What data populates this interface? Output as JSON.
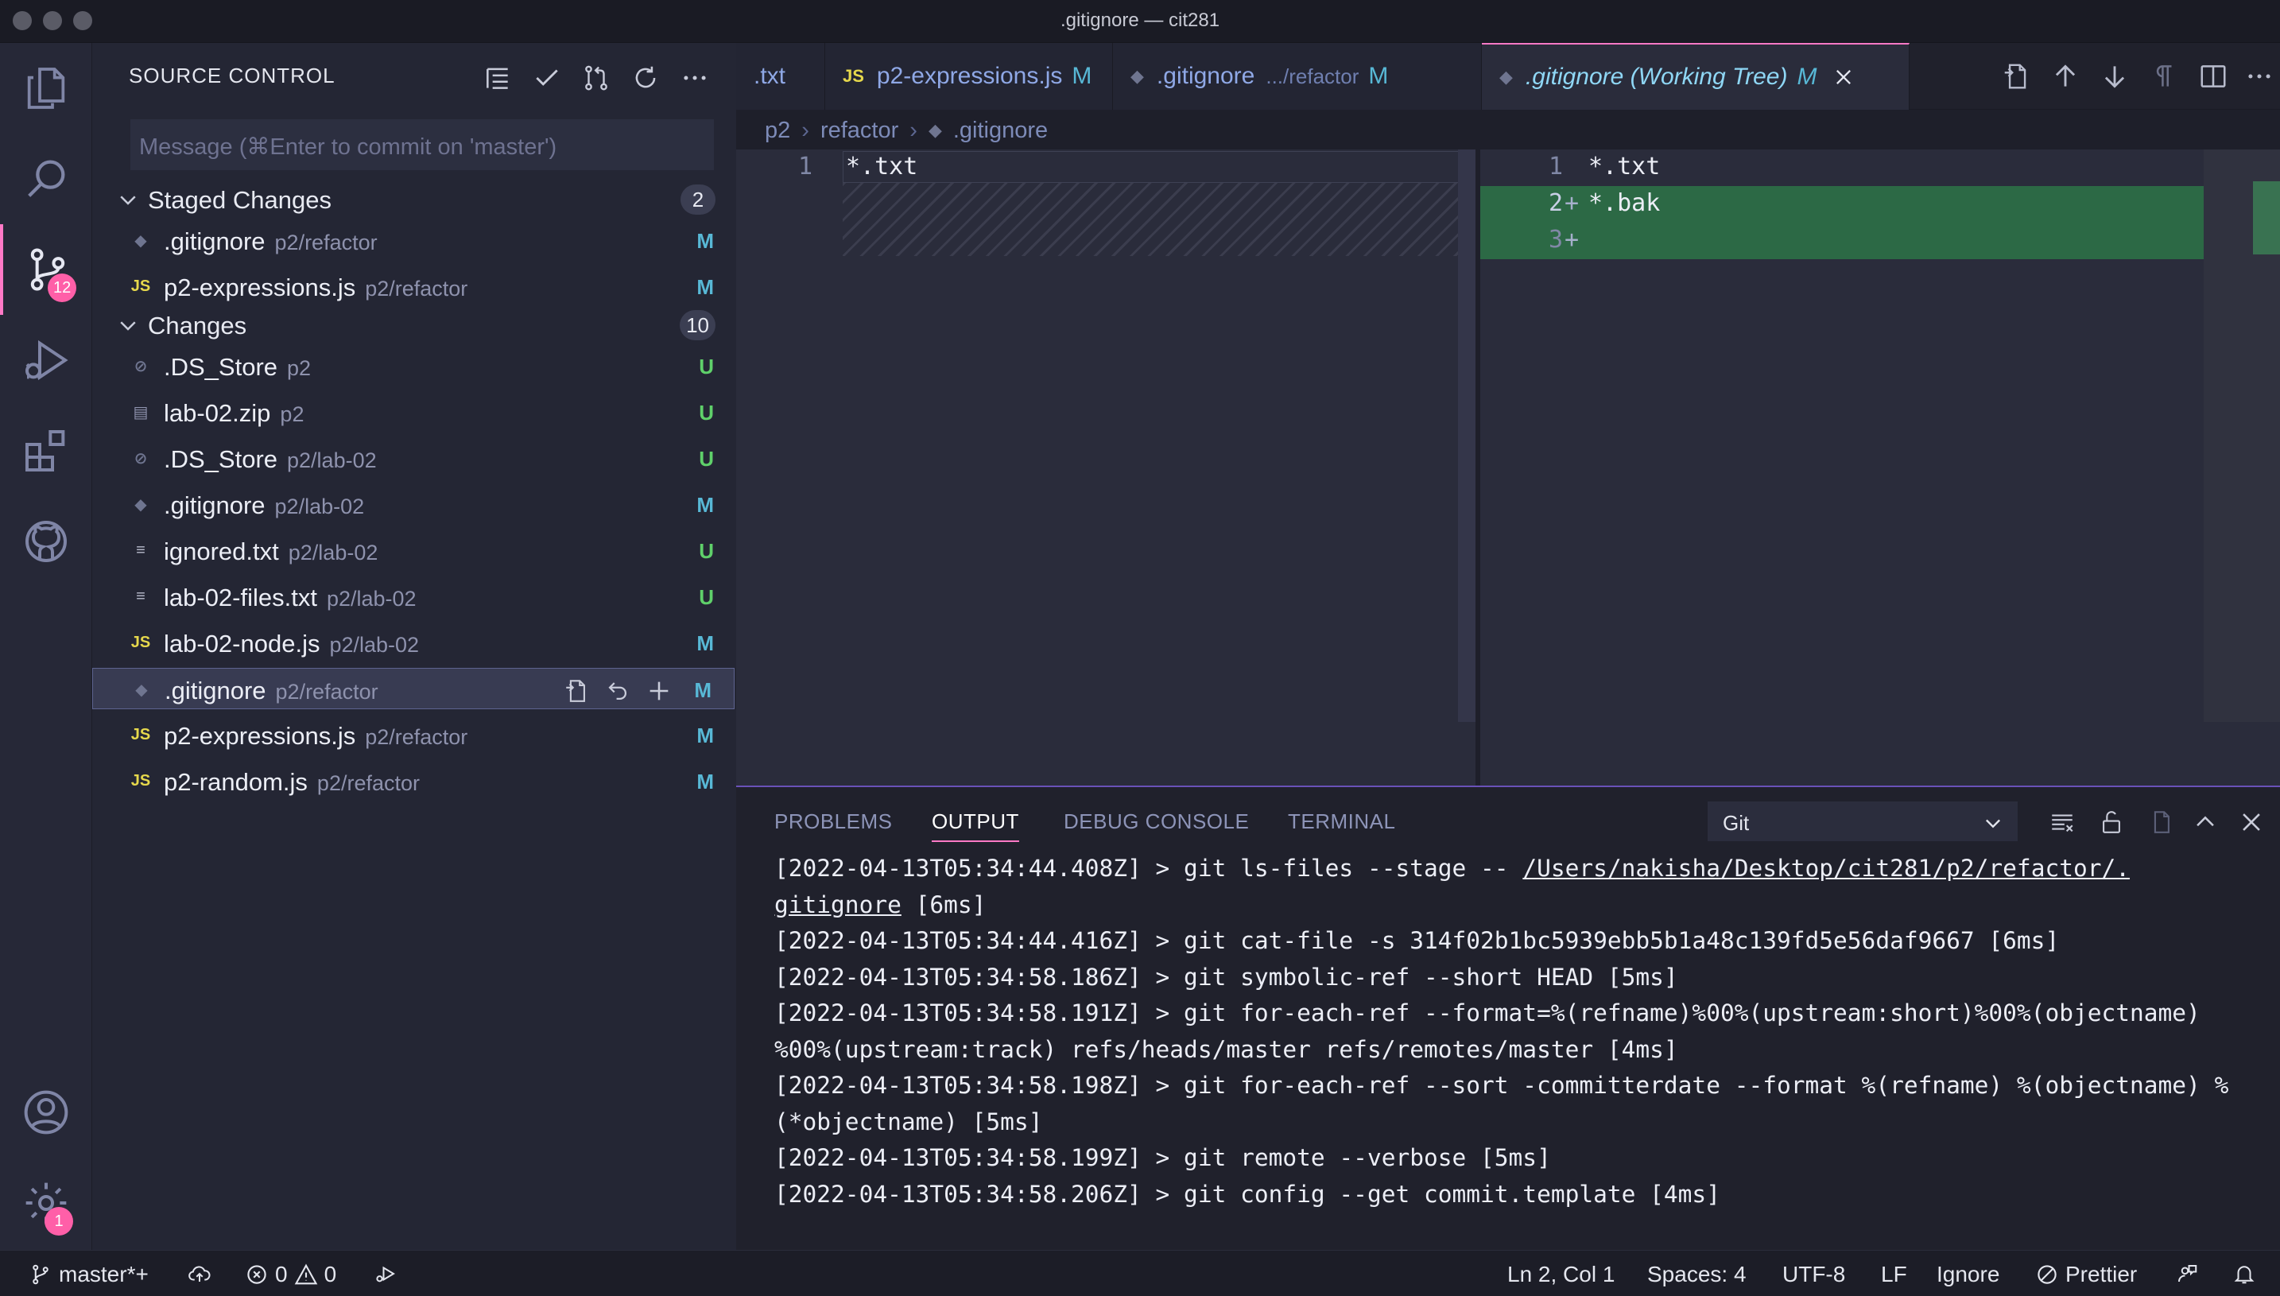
{
  "window": {
    "title": ".gitignore — cit281"
  },
  "activity": {
    "source_control_badge": "12",
    "settings_badge": "1"
  },
  "sidebar": {
    "title": "SOURCE CONTROL",
    "commit_placeholder": "Message (⌘Enter to commit on 'master')",
    "staged": {
      "label": "Staged Changes",
      "count": "2",
      "items": [
        {
          "icon": "git-icon",
          "name": ".gitignore",
          "path": "p2/refactor",
          "status": "M"
        },
        {
          "icon": "js-icon",
          "name": "p2-expressions.js",
          "path": "p2/refactor",
          "status": "M"
        }
      ]
    },
    "changes": {
      "label": "Changes",
      "count": "10",
      "items": [
        {
          "icon": "eye-slash-icon",
          "name": ".DS_Store",
          "path": "p2",
          "status": "U"
        },
        {
          "icon": "zip-icon",
          "name": "lab-02.zip",
          "path": "p2",
          "status": "U"
        },
        {
          "icon": "eye-slash-icon",
          "name": ".DS_Store",
          "path": "p2/lab-02",
          "status": "U"
        },
        {
          "icon": "git-icon",
          "name": ".gitignore",
          "path": "p2/lab-02",
          "status": "M"
        },
        {
          "icon": "text-file-icon",
          "name": "ignored.txt",
          "path": "p2/lab-02",
          "status": "U"
        },
        {
          "icon": "text-file-icon",
          "name": "lab-02-files.txt",
          "path": "p2/lab-02",
          "status": "U"
        },
        {
          "icon": "js-icon",
          "name": "lab-02-node.js",
          "path": "p2/lab-02",
          "status": "M"
        },
        {
          "icon": "git-icon",
          "name": ".gitignore",
          "path": "p2/refactor",
          "status": "M"
        },
        {
          "icon": "js-icon",
          "name": "p2-expressions.js",
          "path": "p2/refactor",
          "status": "M"
        },
        {
          "icon": "js-icon",
          "name": "p2-random.js",
          "path": "p2/refactor",
          "status": "M"
        }
      ]
    }
  },
  "tabs": [
    {
      "label": ".txt",
      "sub": "",
      "mod": ""
    },
    {
      "label": "p2-expressions.js",
      "sub": "",
      "mod": "M",
      "icon": "JS"
    },
    {
      "label": ".gitignore",
      "sub": ".../refactor",
      "mod": "M",
      "icon": "◆"
    },
    {
      "label": ".gitignore (Working Tree)",
      "sub": "",
      "mod": "M",
      "icon": "◆"
    }
  ],
  "breadcrumb": [
    "p2",
    "refactor",
    ".gitignore"
  ],
  "diff": {
    "left": [
      {
        "ln": "1",
        "text": "*.txt"
      }
    ],
    "right": [
      {
        "ln": "1",
        "text": "*.txt",
        "mark": ""
      },
      {
        "ln": "2",
        "text": "*.bak",
        "mark": "+"
      },
      {
        "ln": "3",
        "text": "",
        "mark": "+"
      }
    ]
  },
  "panel": {
    "tabs": [
      "PROBLEMS",
      "OUTPUT",
      "DEBUG CONSOLE",
      "TERMINAL"
    ],
    "channel": "Git",
    "log": [
      "[2022-04-13T05:34:44.408Z] > git ls-files --stage -- ",
      "/Users/nakisha/Desktop/cit281/p2/refactor/.",
      "gitignore",
      " [6ms]",
      "[2022-04-13T05:34:44.416Z] > git cat-file -s 314f02b1bc5939ebb5b1a48c139fd5e56daf9667 [6ms]",
      "[2022-04-13T05:34:58.186Z] > git symbolic-ref --short HEAD [5ms]",
      "[2022-04-13T05:34:58.191Z] > git for-each-ref --format=%(refname)%00%(upstream:short)%00%(objectname)",
      "%00%(upstream:track) refs/heads/master refs/remotes/master [4ms]",
      "[2022-04-13T05:34:58.198Z] > git for-each-ref --sort -committerdate --format %(refname) %(objectname) %",
      "(*objectname) [5ms]",
      "[2022-04-13T05:34:58.199Z] > git remote --verbose [5ms]",
      "[2022-04-13T05:34:58.206Z] > git config --get commit.template [4ms]"
    ]
  },
  "status": {
    "branch": "master*+",
    "errors": "0",
    "warnings": "0",
    "position": "Ln 2, Col 1",
    "spaces": "Spaces: 4",
    "encoding": "UTF-8",
    "eol": "LF",
    "language": "Ignore",
    "prettier": "Prettier"
  },
  "colors": {
    "accent": "#ff79c6",
    "modified": "#58b8d6",
    "untracked": "#5fd06a",
    "added_line": "#2e7d4a"
  }
}
